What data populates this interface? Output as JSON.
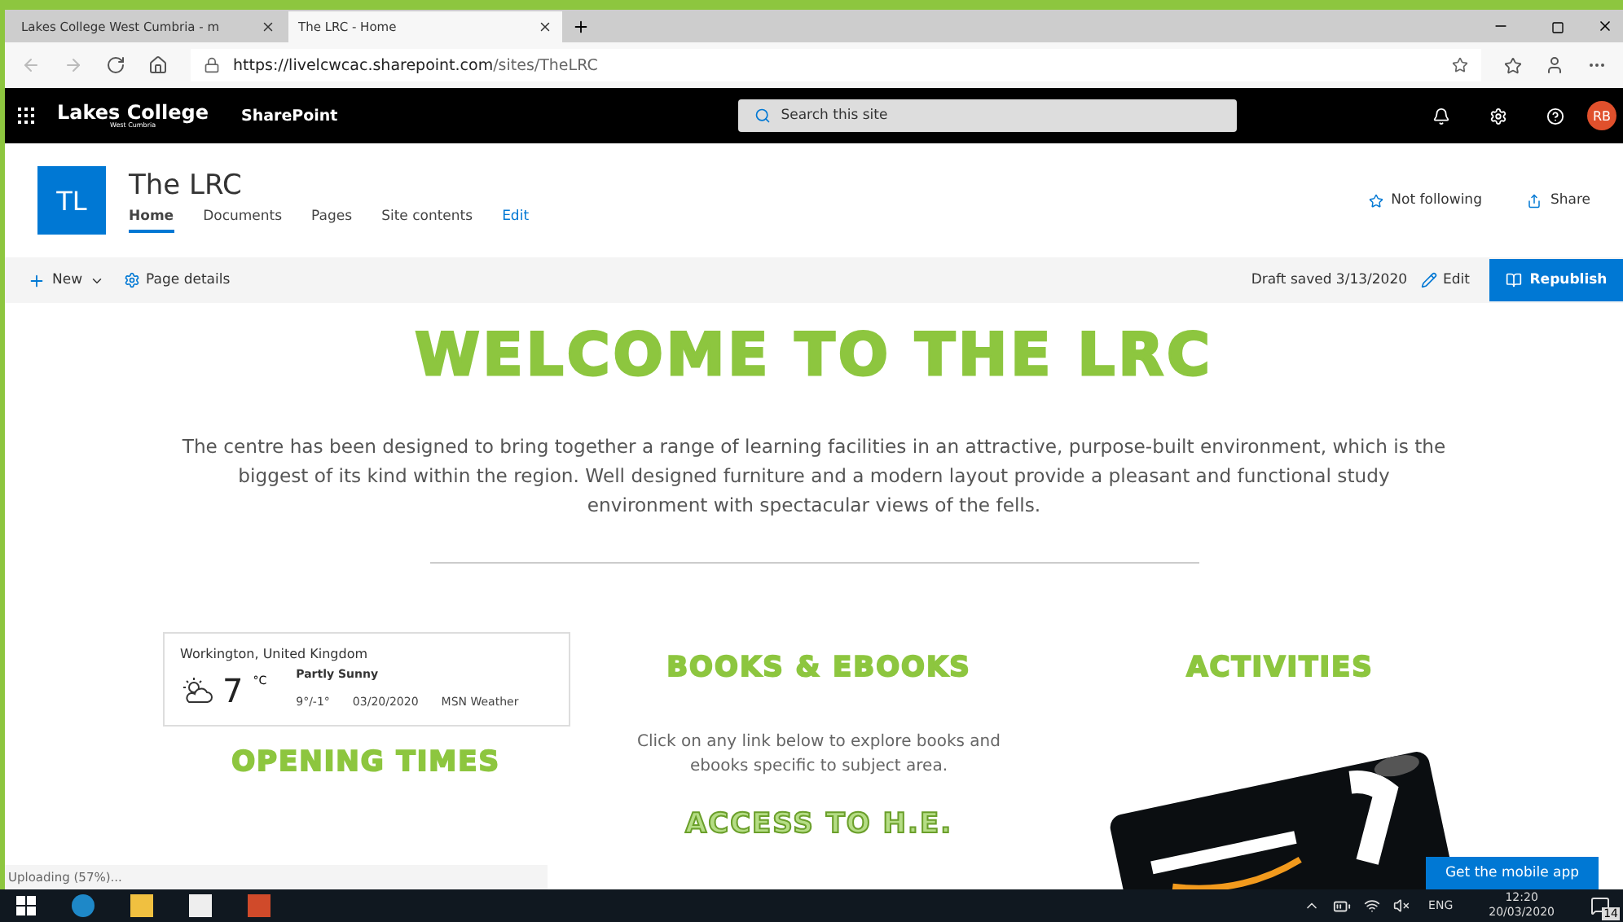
{
  "browser": {
    "tabs": [
      {
        "label": "Lakes College West Cumbria - m",
        "selected": false
      },
      {
        "label": "The LRC - Home",
        "selected": true
      }
    ],
    "url_host": "https://livelcwcac.sharepoint.com",
    "url_path": "/sites/TheLRC"
  },
  "suite_bar": {
    "logo": "Lakes College",
    "logo_sub": "West Cumbria",
    "app": "SharePoint",
    "search": {
      "placeholder": "Search this site"
    },
    "avatar": "RB"
  },
  "site": {
    "logo": "TL",
    "title": "The LRC",
    "nav": [
      {
        "label": "Home",
        "selected": true
      },
      {
        "label": "Documents",
        "selected": false
      },
      {
        "label": "Pages",
        "selected": false
      },
      {
        "label": "Site contents",
        "selected": false
      },
      {
        "label": "Edit",
        "selected": false,
        "kind": "link"
      }
    ],
    "follow": "Not following",
    "share": "Share"
  },
  "command_bar": {
    "new": "New",
    "page_details": "Page details",
    "draft": "Draft saved 3/13/2020",
    "edit": "Edit",
    "republish": "Republish"
  },
  "page": {
    "heading": "WELCOME TO THE LRC",
    "intro": "The centre has been designed to bring together a range of learning facilities in an attractive, purpose-built environment, which is the biggest of its kind within the region. Well designed furniture and a modern layout provide a pleasant and functional study environment with spectacular views of the fells.",
    "weather": {
      "location": "Workington, United Kingdom",
      "temp": "7",
      "unit": "°C",
      "condition": "Partly Sunny",
      "range": "9°/-1°",
      "date": "03/20/2020",
      "source": "MSN Weather"
    },
    "opening_times": {
      "title": "OPENING TIMES"
    },
    "books": {
      "title": "BOOKS & EBOOKS",
      "text": "Click on any link below to explore books and ebooks specific to subject area."
    },
    "access": {
      "title": "ACCESS TO H.E."
    },
    "activities": {
      "title": "ACTIVITIES"
    },
    "mobile_app": "Get the mobile app"
  },
  "status": "Uploading (57%)...",
  "taskbar": {
    "lang": "ENG",
    "time": "12:20",
    "date": "20/03/2020",
    "notifications": "14"
  }
}
